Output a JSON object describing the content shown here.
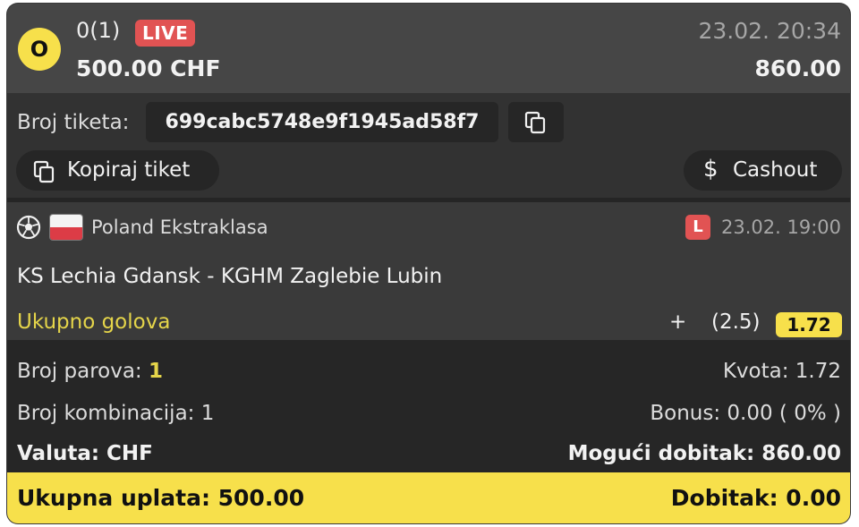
{
  "header": {
    "status_letter": "O",
    "selection_count": "0(1)",
    "live_label": "LIVE",
    "stake": "500.00 CHF",
    "date_time": "23.02. 20:34",
    "potential_win": "860.00"
  },
  "ticket": {
    "id_label": "Broj tiketa:",
    "id_value": "699cabc5748e9f1945ad58f7",
    "copy_ticket_label": "Kopiraj tiket",
    "cashout_symbol": "$",
    "cashout_label": "Cashout"
  },
  "match": {
    "league": "Poland Ekstraklasa",
    "live_badge": "L",
    "date": "23.02. 19:00",
    "teams": "KS Lechia Gdansk - KGHM Zaglebie Lubin",
    "market": "Ukupno golova",
    "pick_sign": "+",
    "pick_line": "(2.5)",
    "odd": "1.72"
  },
  "summary": {
    "pairs_label": "Broj parova:",
    "pairs_value": "1",
    "odds_text": "Kvota: 1.72",
    "combinations_text": "Broj kombinacija: 1",
    "bonus_text": "Bonus: 0.00 ( 0% )",
    "currency_text": "Valuta: CHF",
    "possible_win_text": "Mogući dobitak: 860.00"
  },
  "footer": {
    "total_stake": "Ukupna uplata: 500.00",
    "win": "Dobitak: 0.00"
  },
  "colors": {
    "accent_yellow": "#f7e04b",
    "live_red": "#e15353",
    "market_yellow": "#e5d54a"
  },
  "icons": {
    "copy": "copy-icon",
    "sport": "soccer-ball-icon",
    "flag": "poland-flag-icon"
  }
}
